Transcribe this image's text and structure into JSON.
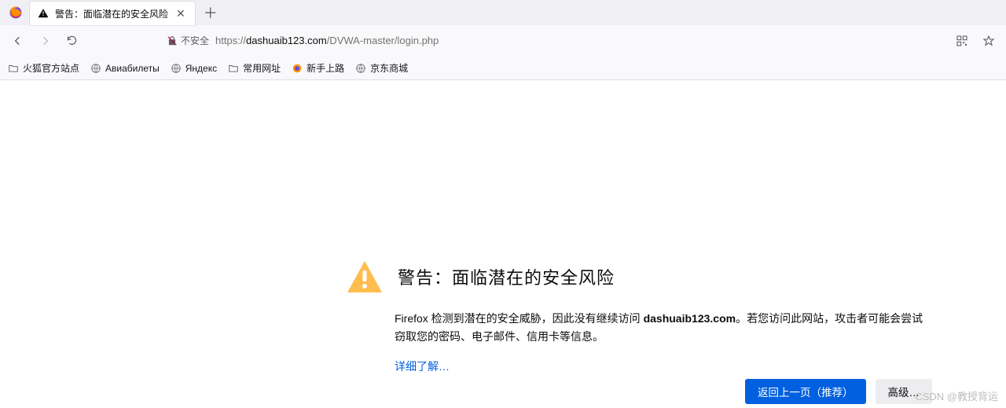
{
  "tab": {
    "title": "警告：面临潜在的安全风险"
  },
  "address": {
    "security_label": "不安全",
    "scheme": "https://",
    "host": "dashuaib123.com",
    "path": "/DVWA-master/login.php"
  },
  "bookmarks": [
    {
      "icon": "folder",
      "label": "火狐官方站点"
    },
    {
      "icon": "globe",
      "label": "Авиабилеты"
    },
    {
      "icon": "globe",
      "label": "Яндекс"
    },
    {
      "icon": "folder",
      "label": "常用网址"
    },
    {
      "icon": "fire",
      "label": "新手上路"
    },
    {
      "icon": "globe",
      "label": "京东商城"
    }
  ],
  "warning": {
    "title": "警告：面临潜在的安全风险",
    "body_pre": "Firefox 检测到潜在的安全威胁，因此没有继续访问 ",
    "body_host": "dashuaib123.com",
    "body_post": "。若您访问此网站，攻击者可能会尝试窃取您的密码、电子邮件、信用卡等信息。",
    "learn_more": "详细了解…",
    "btn_back": "返回上一页（推荐）",
    "btn_adv": "高级…"
  },
  "watermark": "CSDN @教授背运"
}
